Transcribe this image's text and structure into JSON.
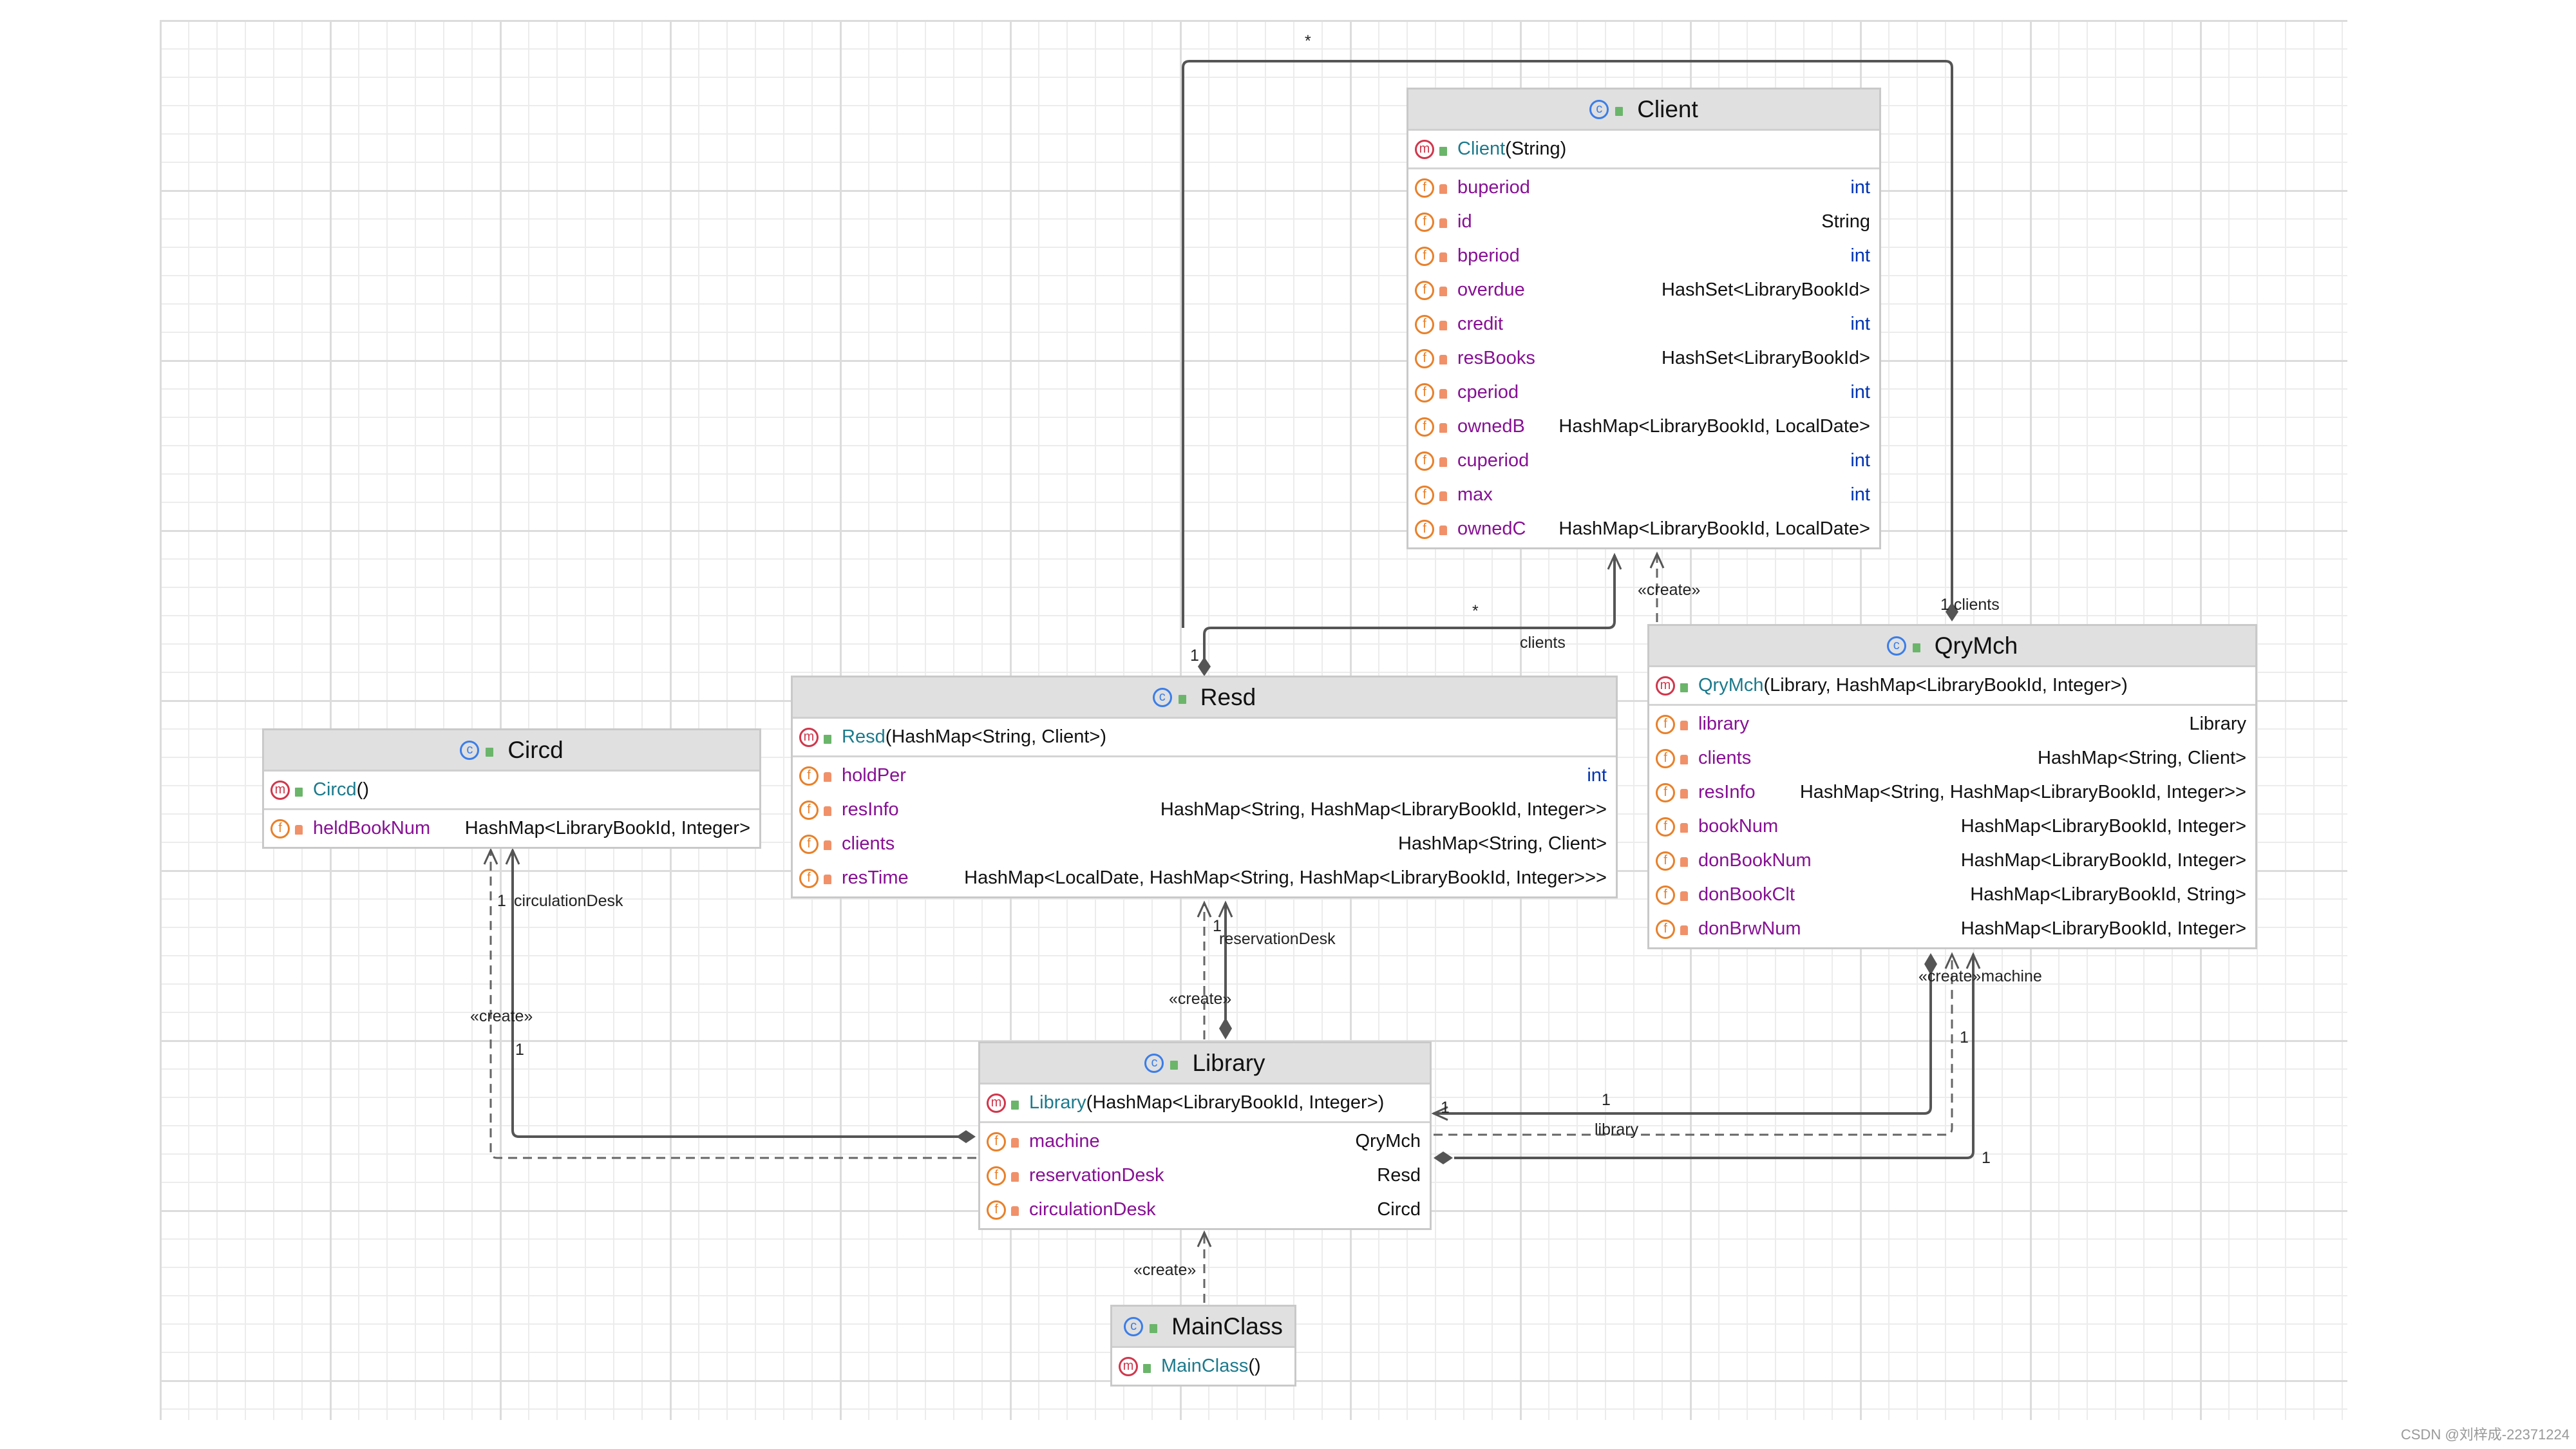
{
  "classes": [
    {
      "id": "client",
      "name": "Client",
      "constructor": {
        "name": "Client",
        "args": "(String)"
      },
      "fields": [
        {
          "name": "buperiod",
          "type": "int"
        },
        {
          "name": "id",
          "type": "String"
        },
        {
          "name": "bperiod",
          "type": "int"
        },
        {
          "name": "overdue",
          "type": "HashSet<LibraryBookId>"
        },
        {
          "name": "credit",
          "type": "int"
        },
        {
          "name": "resBooks",
          "type": "HashSet<LibraryBookId>"
        },
        {
          "name": "cperiod",
          "type": "int"
        },
        {
          "name": "ownedB",
          "type": "HashMap<LibraryBookId, LocalDate>"
        },
        {
          "name": "cuperiod",
          "type": "int"
        },
        {
          "name": "max",
          "type": "int"
        },
        {
          "name": "ownedC",
          "type": "HashMap<LibraryBookId, LocalDate>"
        }
      ]
    },
    {
      "id": "resd",
      "name": "Resd",
      "constructor": {
        "name": "Resd",
        "args": "(HashMap<String, Client>)"
      },
      "fields": [
        {
          "name": "holdPer",
          "type": "int"
        },
        {
          "name": "resInfo",
          "type": "HashMap<String, HashMap<LibraryBookId, Integer>>"
        },
        {
          "name": "clients",
          "type": "HashMap<String, Client>"
        },
        {
          "name": "resTime",
          "type": "HashMap<LocalDate, HashMap<String, HashMap<LibraryBookId, Integer>>>"
        }
      ]
    },
    {
      "id": "circd",
      "name": "Circd",
      "constructor": {
        "name": "Circd",
        "args": "()"
      },
      "fields": [
        {
          "name": "heldBookNum",
          "type": "HashMap<LibraryBookId, Integer>"
        }
      ]
    },
    {
      "id": "qrymch",
      "name": "QryMch",
      "constructor": {
        "name": "QryMch",
        "args": "(Library, HashMap<LibraryBookId, Integer>)"
      },
      "fields": [
        {
          "name": "library",
          "type": "Library"
        },
        {
          "name": "clients",
          "type": "HashMap<String, Client>"
        },
        {
          "name": "resInfo",
          "type": "HashMap<String, HashMap<LibraryBookId, Integer>>"
        },
        {
          "name": "bookNum",
          "type": "HashMap<LibraryBookId, Integer>"
        },
        {
          "name": "donBookNum",
          "type": "HashMap<LibraryBookId, Integer>"
        },
        {
          "name": "donBookClt",
          "type": "HashMap<LibraryBookId, String>"
        },
        {
          "name": "donBrwNum",
          "type": "HashMap<LibraryBookId, Integer>"
        }
      ]
    },
    {
      "id": "library",
      "name": "Library",
      "constructor": {
        "name": "Library",
        "args": "(HashMap<LibraryBookId, Integer>)"
      },
      "fields": [
        {
          "name": "machine",
          "type": "QryMch"
        },
        {
          "name": "reservationDesk",
          "type": "Resd"
        },
        {
          "name": "circulationDesk",
          "type": "Circd"
        }
      ]
    },
    {
      "id": "mainclass",
      "name": "MainClass",
      "constructor": {
        "name": "MainClass",
        "args": "()"
      },
      "fields": []
    }
  ],
  "labels": {
    "star_top": "*",
    "one_clients": "1 clients",
    "star_mid": "*",
    "clients": "clients",
    "one_resd": "1",
    "create_client": "«create»",
    "one_resv": "1",
    "reservationDesk": "reservationDesk",
    "create_resd": "«create»",
    "one_circ": "1",
    "circulationDesk": "circulationDesk",
    "create_circd": "«create»",
    "one_circ2": "1",
    "one_lib_a": "1",
    "one_lib_b": "1",
    "library": "library",
    "create_machine": "«create»machine",
    "one_machine": "1",
    "one_machine2": "1",
    "create_library": "«create»"
  },
  "icons": {
    "class": "class-icon",
    "method": "method-icon",
    "field": "field-icon",
    "public": "unlock-icon",
    "private": "lock-icon"
  },
  "colors": {
    "field_name": "#871094",
    "constructor_name": "#1c7a8c",
    "primitive_type": "#0033b3",
    "header_bg": "#e0e0e0"
  },
  "watermark": "CSDN @刘梓成-22371224"
}
